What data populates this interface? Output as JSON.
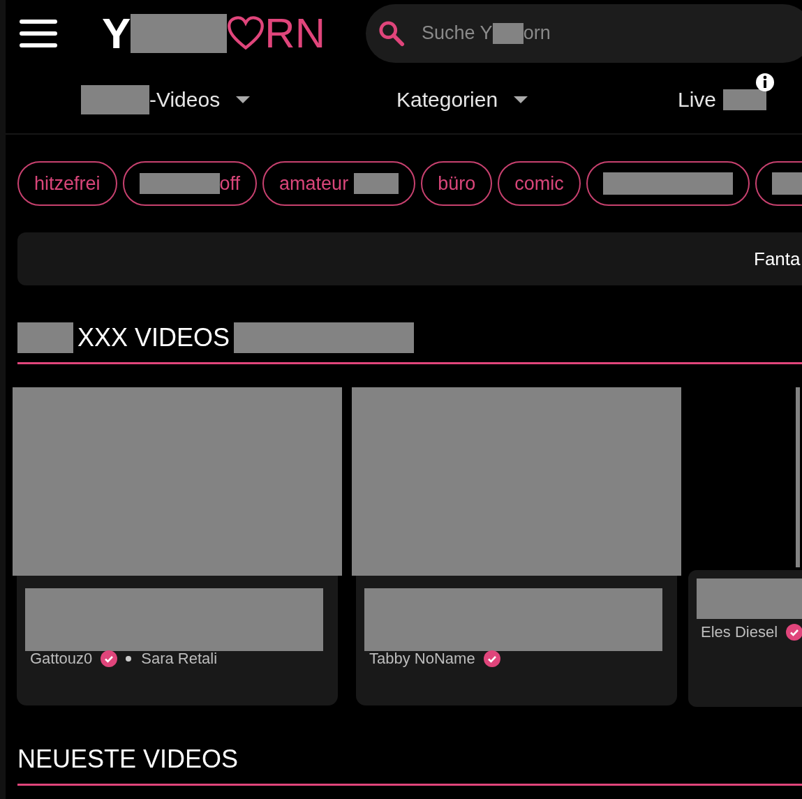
{
  "header": {
    "logo_start": "Y",
    "logo_end": "RN",
    "search": {
      "placeholder_parts": [
        "Suche Y",
        "orn"
      ]
    }
  },
  "nav": [
    {
      "label": "-Videos",
      "mask_before": true,
      "mask_after": false,
      "dropdown": true,
      "info": false
    },
    {
      "label": "Kategorien",
      "mask_before": false,
      "mask_after": false,
      "dropdown": true,
      "info": false
    },
    {
      "label": "Live",
      "mask_before": false,
      "mask_after": true,
      "dropdown": false,
      "info": true
    }
  ],
  "tags": [
    {
      "label": "hitzefrei",
      "mask_before": false,
      "mask_after": false
    },
    {
      "label": "off",
      "mask_before": true,
      "mask_after": false
    },
    {
      "label": "amateur",
      "mask_before": false,
      "mask_after": true
    },
    {
      "label": "büro",
      "mask_before": false,
      "mask_after": false
    },
    {
      "label": "comic",
      "mask_before": false,
      "mask_after": false
    },
    {
      "mask_before": true,
      "mask_after": false
    },
    {
      "mask_before": true,
      "mask_after": false
    }
  ],
  "banner": {
    "text": "Fanta"
  },
  "sections": [
    {
      "title": "XXX VIDEOS",
      "masked": true,
      "videos": [
        {
          "kind": "full",
          "creators": [
            {
              "name": "Gattouz0",
              "verified": true
            },
            {
              "name": "Sara Retali",
              "verified": false
            }
          ]
        },
        {
          "kind": "full",
          "creators": [
            {
              "name": "Tabby NoName",
              "verified": true
            }
          ]
        },
        {
          "kind": "narrow",
          "creators": [
            {
              "name": "Eles Diesel",
              "verified": true
            }
          ]
        }
      ]
    },
    {
      "title": "NEUESTE VIDEOS",
      "masked": false
    }
  ]
}
